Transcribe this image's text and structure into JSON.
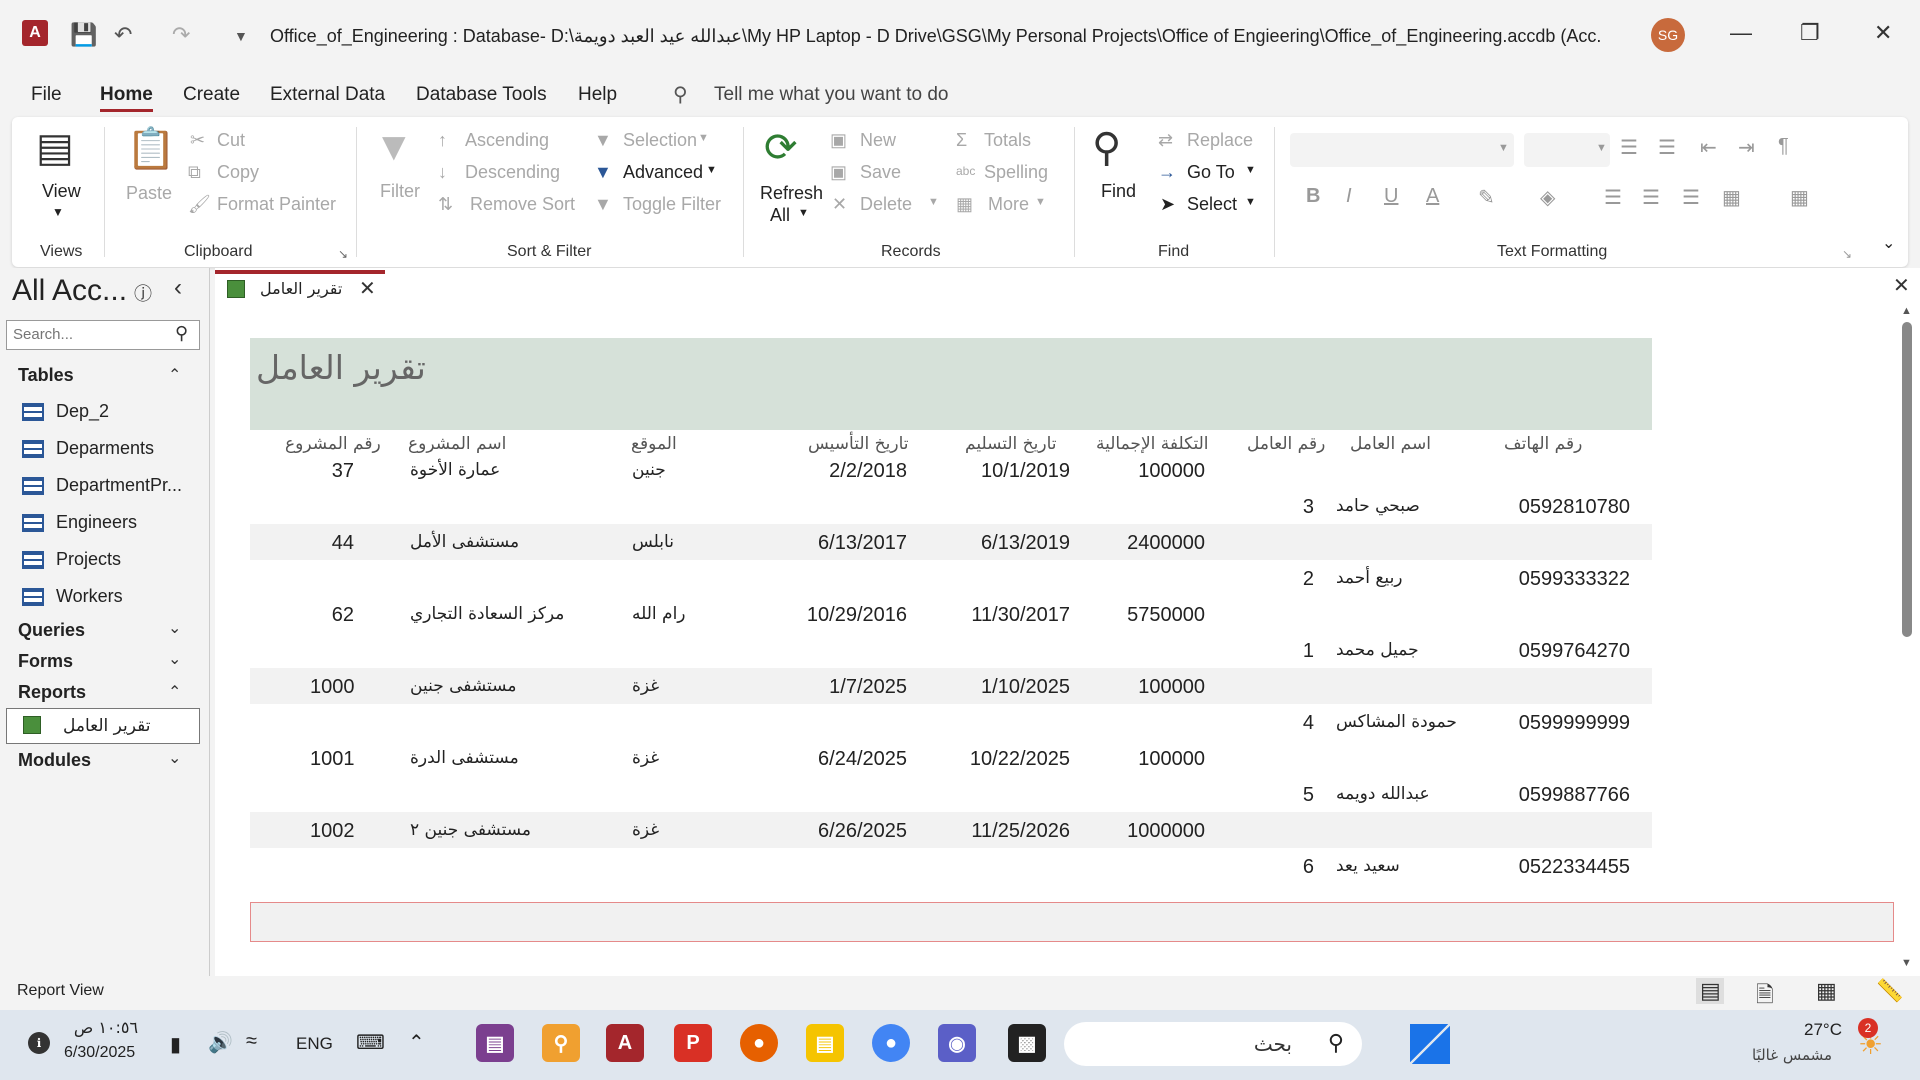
{
  "window": {
    "title": "Office_of_Engineering : Database- D:\\عبدالله عيد العبد دويمة\\My HP Laptop - D Drive\\GSG\\My Personal Projects\\Office of Engieering\\Office_of_Engineering.accdb (Acc...",
    "user_initials": "SG"
  },
  "menu": {
    "items": [
      "File",
      "Home",
      "Create",
      "External Data",
      "Database Tools",
      "Help"
    ],
    "tell_me": "Tell me what you want to do"
  },
  "ribbon": {
    "views": {
      "view": "View",
      "label": "Views"
    },
    "clipboard": {
      "paste": "Paste",
      "cut": "Cut",
      "copy": "Copy",
      "format_painter": "Format Painter",
      "label": "Clipboard"
    },
    "sort_filter": {
      "filter": "Filter",
      "ascending": "Ascending",
      "descending": "Descending",
      "remove_sort": "Remove Sort",
      "selection": "Selection",
      "advanced": "Advanced",
      "toggle_filter": "Toggle Filter",
      "label": "Sort & Filter"
    },
    "records": {
      "refresh": "Refresh",
      "refresh2": "All",
      "new": "New",
      "save": "Save",
      "delete": "Delete",
      "totals": "Totals",
      "spelling": "Spelling",
      "more": "More",
      "label": "Records"
    },
    "find": {
      "find": "Find",
      "replace": "Replace",
      "goto": "Go To",
      "select": "Select",
      "label": "Find"
    },
    "text_formatting": {
      "label": "Text Formatting"
    }
  },
  "nav": {
    "title": "All Acc...",
    "search_placeholder": "Search...",
    "tables_label": "Tables",
    "tables": [
      "Dep_2",
      "Deparments",
      "DepartmentPr...",
      "Engineers",
      "Projects",
      "Workers"
    ],
    "queries_label": "Queries",
    "forms_label": "Forms",
    "reports_label": "Reports",
    "reports": [
      "تقرير العامل"
    ],
    "modules_label": "Modules"
  },
  "tab": {
    "label": "تقرير العامل"
  },
  "report": {
    "title": "تقرير العامل",
    "columns": {
      "project_no": "رقم المشروع",
      "project_name": "اسم المشروع",
      "location": "الموقع",
      "founded": "تاريخ التأسيس",
      "delivery": "تاريخ التسليم",
      "cost": "التكلفة الإجمالية",
      "worker_no": "رقم العامل",
      "worker_name": "اسم العامل",
      "phone": "رقم الهاتف"
    },
    "projects": [
      {
        "project_no": "37",
        "project_name": "عمارة الأخوة",
        "location": "جنين",
        "founded": "2/2/2018",
        "delivery": "10/1/2019",
        "cost": "100000",
        "worker_no": "3",
        "worker_name": "صبحي حامد",
        "phone": "0592810780"
      },
      {
        "project_no": "44",
        "project_name": "مستشفى الأمل",
        "location": "نابلس",
        "founded": "6/13/2017",
        "delivery": "6/13/2019",
        "cost": "2400000",
        "worker_no": "2",
        "worker_name": "ربيع أحمد",
        "phone": "0599333322"
      },
      {
        "project_no": "62",
        "project_name": "مركز السعادة التجاري",
        "location": "رام الله",
        "founded": "10/29/2016",
        "delivery": "11/30/2017",
        "cost": "5750000",
        "worker_no": "1",
        "worker_name": "جميل محمد",
        "phone": "0599764270"
      },
      {
        "project_no": "1000",
        "project_name": "مستشفى جنين",
        "location": "غزة",
        "founded": "1/7/2025",
        "delivery": "1/10/2025",
        "cost": "100000",
        "worker_no": "4",
        "worker_name": "حمودة المشاكس",
        "phone": "0599999999"
      },
      {
        "project_no": "1001",
        "project_name": "مستشفى الدرة",
        "location": "غزة",
        "founded": "6/24/2025",
        "delivery": "10/22/2025",
        "cost": "100000",
        "worker_no": "5",
        "worker_name": "عبدالله دويمه",
        "phone": "0599887766"
      },
      {
        "project_no": "1002",
        "project_name": "مستشفى جنين ٢",
        "location": "غزة",
        "founded": "6/26/2025",
        "delivery": "11/25/2026",
        "cost": "1000000",
        "worker_no": "6",
        "worker_name": "سعيد يعد",
        "phone": "0522334455"
      }
    ]
  },
  "status": {
    "text": "Report View"
  },
  "taskbar": {
    "time": "١٠:٥٦ ص",
    "date": "6/30/2025",
    "lang": "ENG",
    "search": "بحث",
    "weather_temp": "27°C",
    "weather_desc": "مشمس غالبًا",
    "notif_count": "2"
  },
  "colors": {
    "accent": "#a4262c",
    "report_header": "#d6e1d9",
    "band": "#f2f2f2"
  }
}
